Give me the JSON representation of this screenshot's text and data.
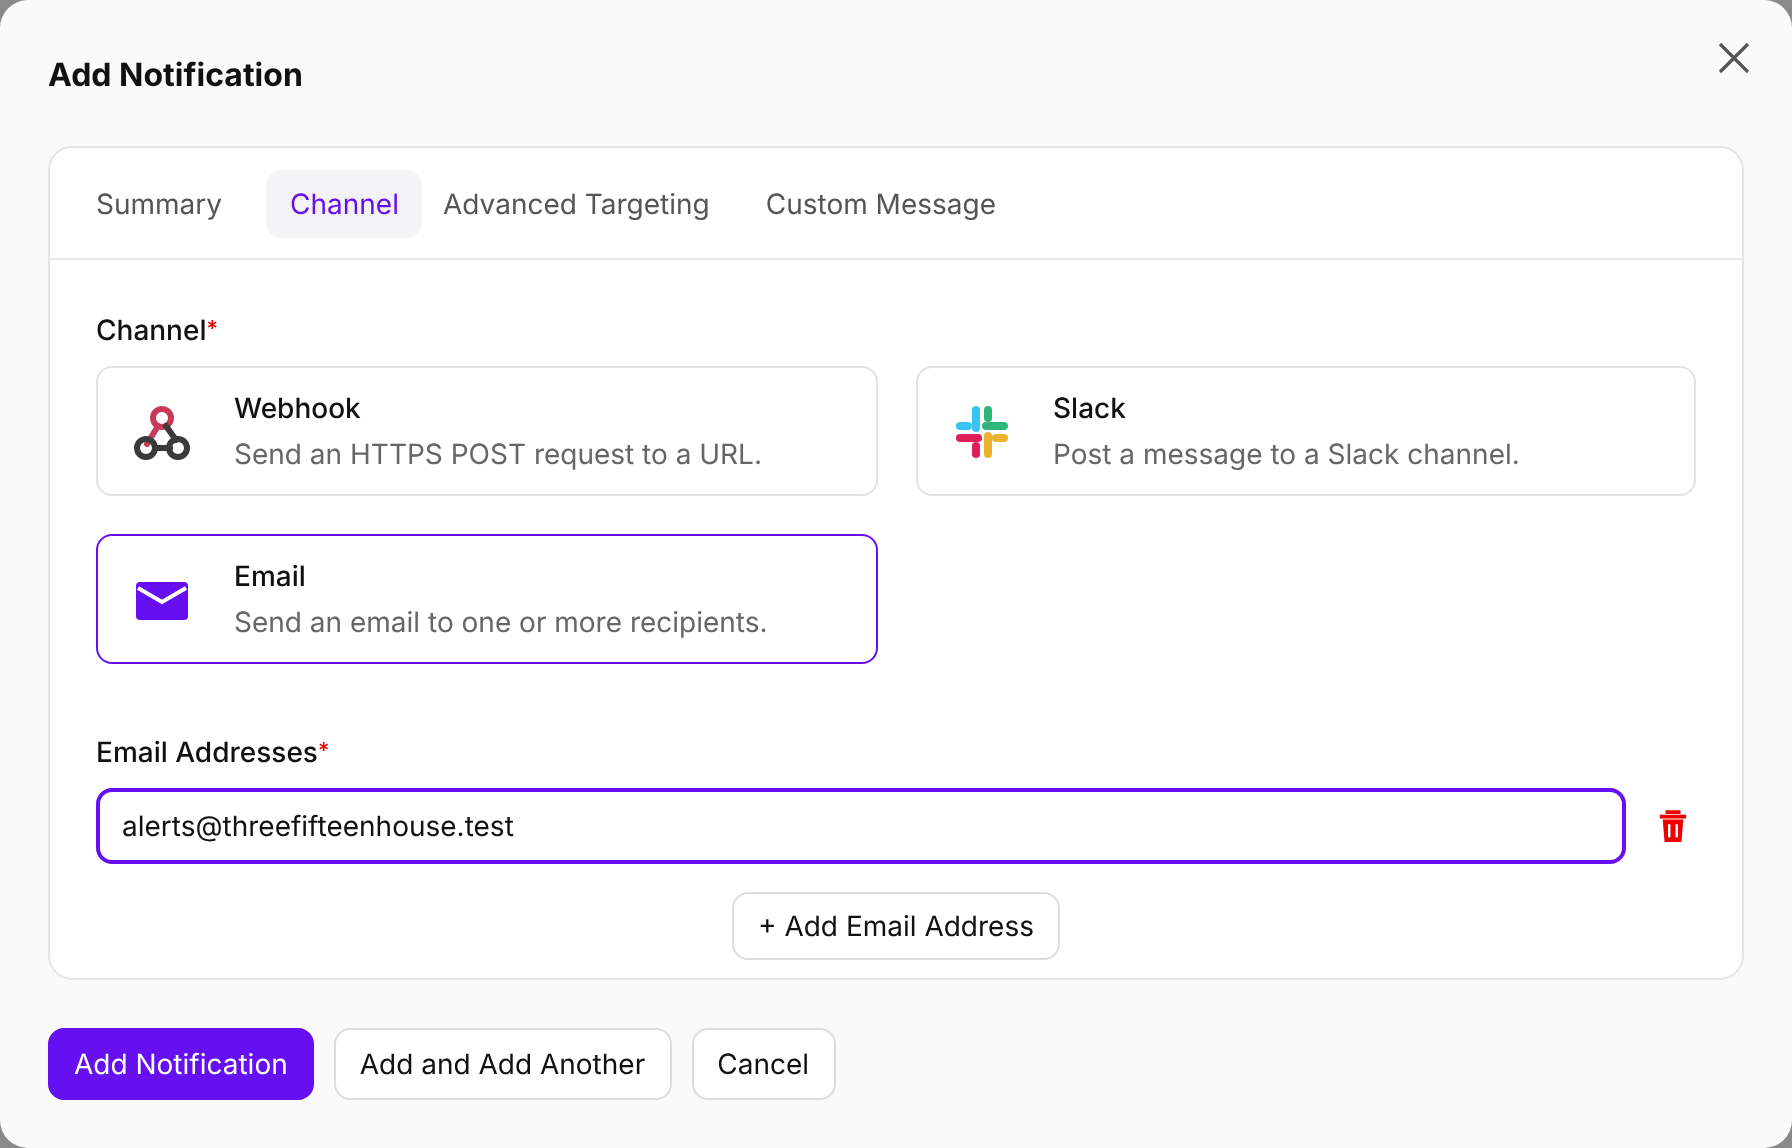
{
  "dialog": {
    "title": "Add Notification"
  },
  "tabs": [
    {
      "label": "Summary",
      "selected": false
    },
    {
      "label": "Channel",
      "selected": true
    },
    {
      "label": "Advanced Targeting",
      "selected": false
    },
    {
      "label": "Custom Message",
      "selected": false
    }
  ],
  "channel_field": {
    "label": "Channel",
    "required_mark": "*",
    "options": [
      {
        "kind": "webhook",
        "title": "Webhook",
        "description": "Send an HTTPS POST request to a URL.",
        "selected": false
      },
      {
        "kind": "slack",
        "title": "Slack",
        "description": "Post a message to a Slack channel.",
        "selected": false
      },
      {
        "kind": "email",
        "title": "Email",
        "description": "Send an email to one or more recipients.",
        "selected": true
      }
    ]
  },
  "email_field": {
    "label": "Email Addresses",
    "required_mark": "*",
    "addresses": [
      "alerts@threefifteenhouse.test"
    ],
    "add_button": "+ Add Email Address"
  },
  "footer_buttons": [
    {
      "label": "Add Notification",
      "kind": "primary"
    },
    {
      "label": "Add and Add Another",
      "kind": "secondary"
    },
    {
      "label": "Cancel",
      "kind": "secondary"
    }
  ]
}
